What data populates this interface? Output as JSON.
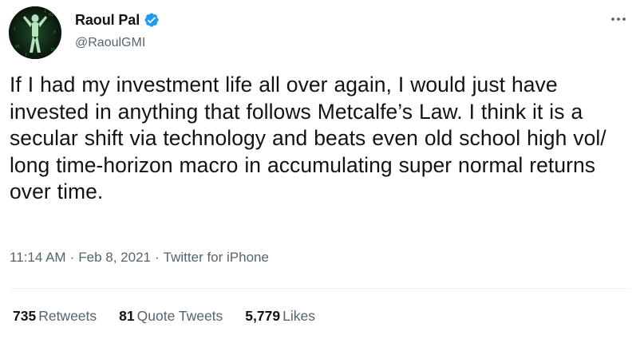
{
  "author": {
    "display_name": "Raoul Pal",
    "handle": "@RaoulGMI",
    "verified": true,
    "avatar_icon": "avatar-matrix-figure"
  },
  "tweet": {
    "text": "If I had my investment life all over again, I would just have invested in anything that follows Metcalfe’s Law. I think it is a secular shift via technology and beats even old school high vol/ long time-horizon macro in accumulating super normal returns over time."
  },
  "meta": {
    "time": "11:14 AM",
    "date": "Feb 8, 2021",
    "separator": "·",
    "source": "Twitter for iPhone"
  },
  "stats": {
    "retweets_count": "735",
    "retweets_label": "Retweets",
    "quotes_count": "81",
    "quotes_label": "Quote Tweets",
    "likes_count": "5,779",
    "likes_label": "Likes"
  },
  "icons": {
    "verified": "verified-badge-icon",
    "more": "more-options-icon"
  },
  "colors": {
    "text_primary": "#0f1419",
    "text_secondary": "#536471",
    "verified_blue": "#1d9bf0",
    "divider": "#eff3f4"
  }
}
